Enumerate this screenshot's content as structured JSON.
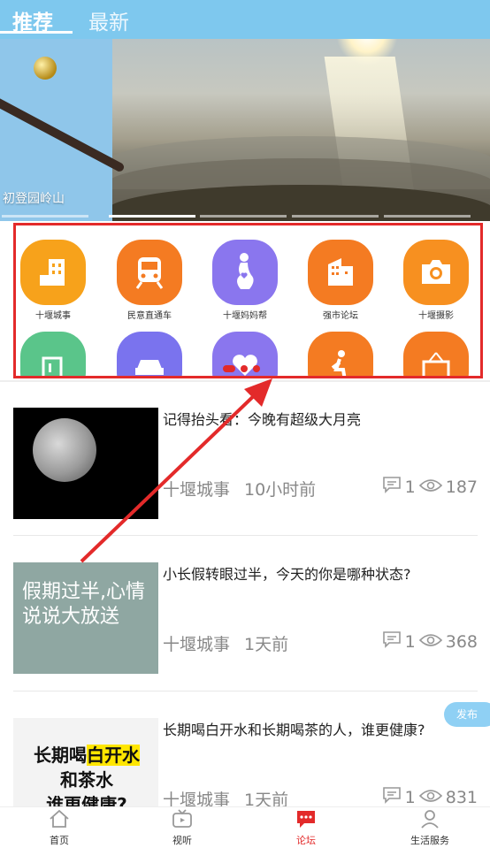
{
  "top_tabs": [
    {
      "label": "推荐",
      "active": true
    },
    {
      "label": "最新",
      "active": false
    }
  ],
  "banner": {
    "caption": "初登园岭山",
    "slide_count": 5,
    "active_slide": 2
  },
  "grid": {
    "items": [
      {
        "label": "十堰城事",
        "color": "#f7a21b",
        "icon": "building-icon"
      },
      {
        "label": "民意直通车",
        "color": "#f47b22",
        "icon": "train-icon"
      },
      {
        "label": "十堰妈妈帮",
        "color": "#8a76ee",
        "icon": "pregnant-icon"
      },
      {
        "label": "强市论坛",
        "color": "#f47b22",
        "icon": "office-icon"
      },
      {
        "label": "十堰摄影",
        "color": "#f79020",
        "icon": "camera-icon"
      },
      {
        "label": "",
        "color": "#5ac58a",
        "icon": "door-icon"
      },
      {
        "label": "",
        "color": "#7a73ee",
        "icon": "car-icon"
      },
      {
        "label": "",
        "color": "#8a76ee",
        "icon": "heart-icon"
      },
      {
        "label": "",
        "color": "#f47b22",
        "icon": "walking-icon"
      },
      {
        "label": "",
        "color": "#f47b22",
        "icon": "sign-icon"
      }
    ],
    "pager_pages": 3,
    "pager_active": 1
  },
  "posts": [
    {
      "title": "记得抬头看：今晚有超级大月亮",
      "source": "十堰城事",
      "time": "10小时前",
      "comments": "1",
      "views": "187",
      "thumb": "moon"
    },
    {
      "title": "小长假转眼过半，今天的你是哪种状态?",
      "source": "十堰城事",
      "time": "1天前",
      "comments": "1",
      "views": "368",
      "thumb": "text",
      "thumb_text": "假期过半,心情说说大放送"
    },
    {
      "title": "长期喝白开水和长期喝茶的人，谁更健康?",
      "source": "十堰城事",
      "time": "1天前",
      "comments": "1",
      "views": "831",
      "thumb": "text",
      "thumb_text_1": "长期喝",
      "thumb_text_hl": "白开水",
      "thumb_text_2": "和茶水",
      "thumb_text_3": "谁更健康?"
    }
  ],
  "publish_label": "发布",
  "bottom_nav": [
    {
      "label": "首页",
      "icon": "home-icon",
      "active": false
    },
    {
      "label": "视听",
      "icon": "tv-icon",
      "active": false
    },
    {
      "label": "论坛",
      "icon": "chat-icon",
      "active": true
    },
    {
      "label": "生活服务",
      "icon": "person-icon",
      "active": false
    }
  ],
  "colors": {
    "topbar": "#7ec8ee",
    "highlight_frame": "#e32a2a",
    "active_nav": "#e32a2a"
  }
}
